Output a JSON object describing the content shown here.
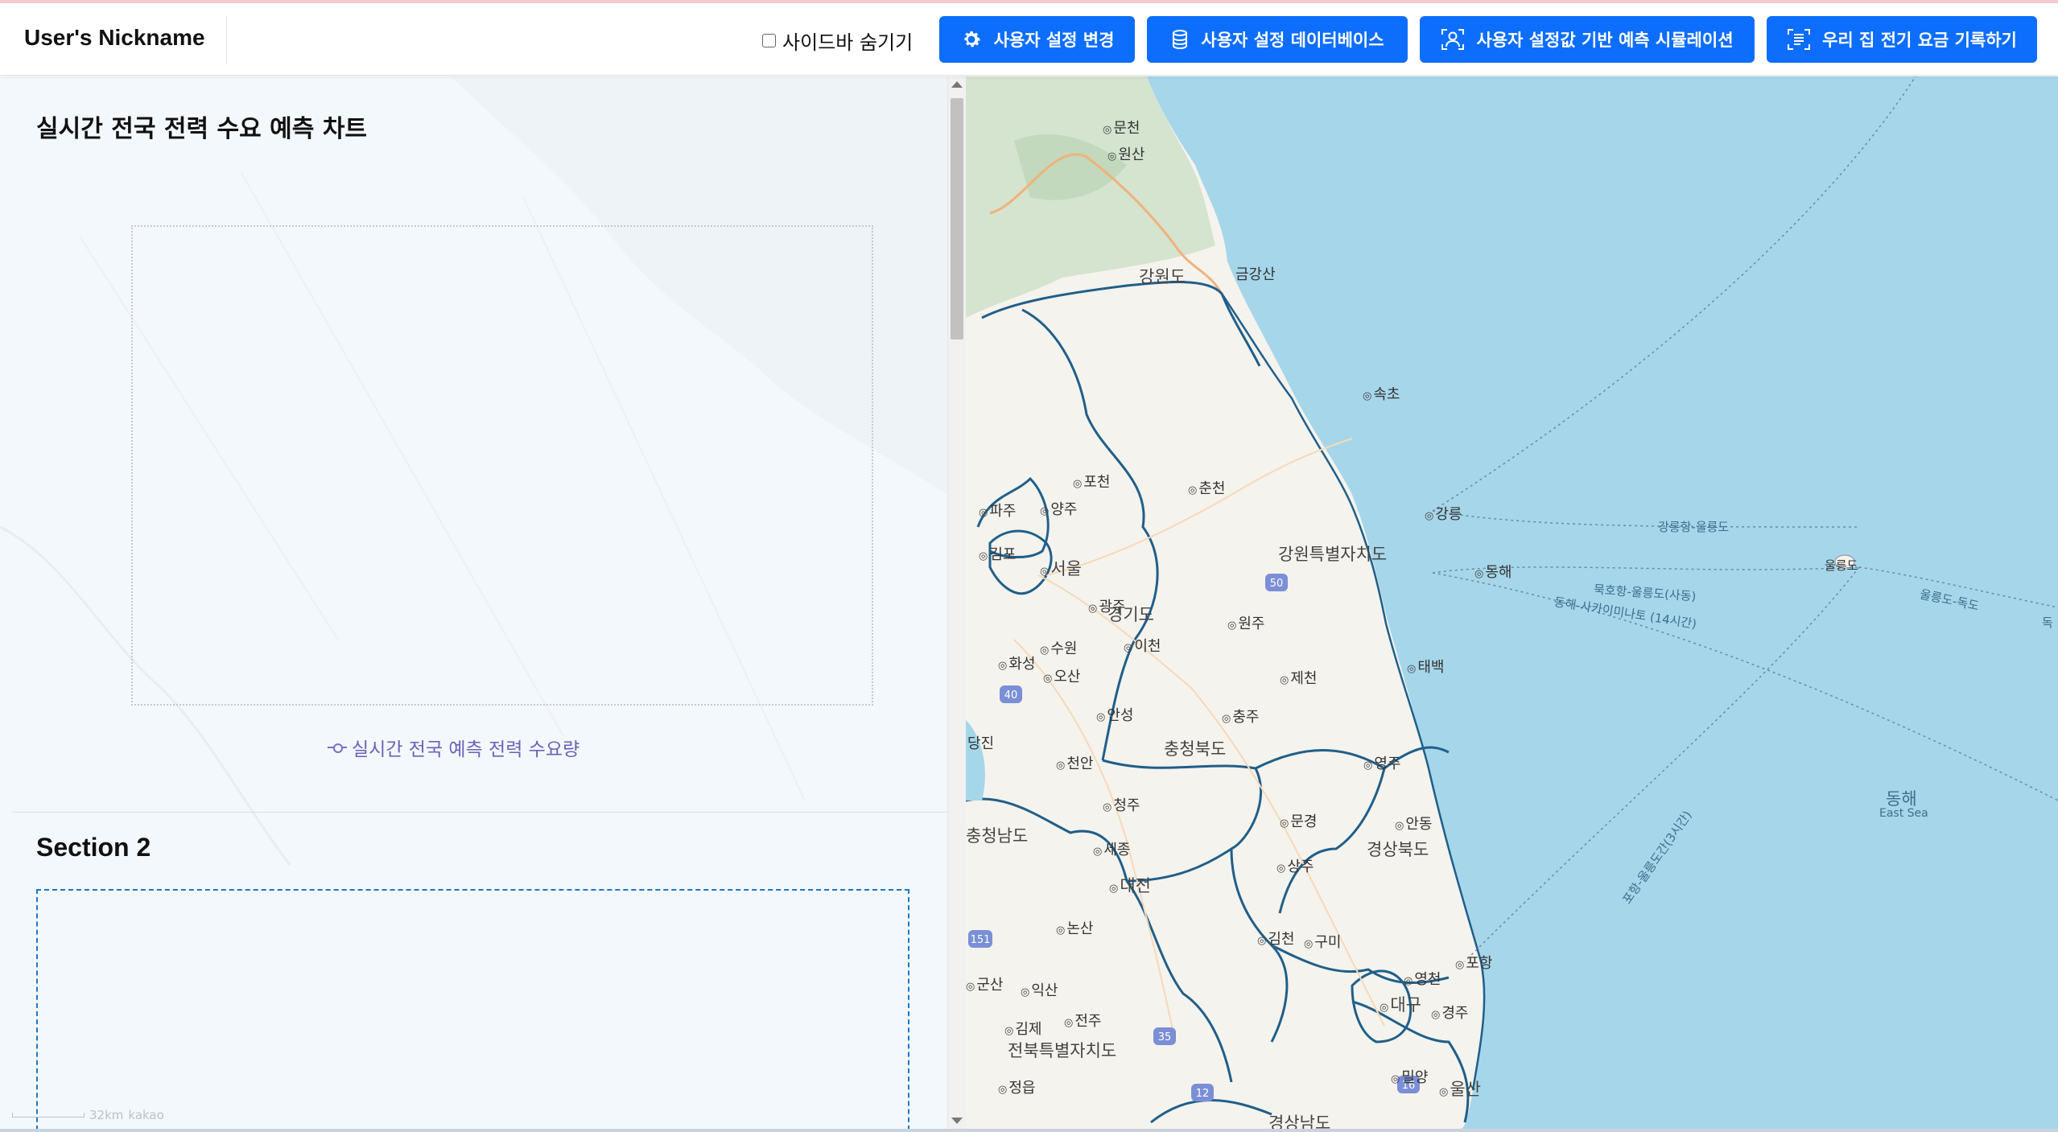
{
  "header": {
    "brand": "User's Nickname",
    "sidebar_toggle_label": "사이드바 숨기기",
    "buttons": [
      {
        "label": "사용자 설정 변경",
        "icon": "gear-icon"
      },
      {
        "label": "사용자 설정 데이터베이스",
        "icon": "database-icon"
      },
      {
        "label": "사용자 설정값 기반 예측 시뮬레이션",
        "icon": "user-scan-icon"
      },
      {
        "label": "우리 집 전기 요금 기록하기",
        "icon": "receipt-scan-icon"
      }
    ]
  },
  "left_panel": {
    "section1_title": "실시간 전국 전력 수요 예측 차트",
    "chart_legend": "실시간 전국 예측 전력 수요량",
    "section2_title": "Section 2",
    "scale_text": "32km",
    "scale_brand": "kakao"
  },
  "map": {
    "labels": {
      "munchon": "문천",
      "wonsan": "원산",
      "gangwondo": "강원도",
      "geumgangsan": "금강산",
      "sokcho": "속초",
      "pocheon": "포천",
      "chuncheon": "춘천",
      "yangju": "양주",
      "paju": "파주",
      "gangneung": "강릉",
      "gangwon_special": "강원특별자치도",
      "gimpo": "김포",
      "seoul": "서울",
      "gwangju_gg": "광주",
      "gyeonggido": "경기도",
      "wonju": "원주",
      "donghae_city": "동해",
      "suwon": "수원",
      "icheon": "이천",
      "hwaseong": "화성",
      "osan": "오산",
      "jecheon": "제천",
      "taebaek": "태백",
      "anseong": "안성",
      "chungju": "충주",
      "dangjin": "당진",
      "cheonan": "천안",
      "chungbuk": "충청북도",
      "yeongju": "영주",
      "cheongju": "청주",
      "mungyeong": "문경",
      "andong": "안동",
      "chungnam": "충청남도",
      "sejong": "세종",
      "sangju": "상주",
      "gyeongbuk": "경상북도",
      "daejeon": "대전",
      "nonsan": "논산",
      "gimcheon": "김천",
      "gumi": "구미",
      "pohang": "포항",
      "gunsan": "군산",
      "iksan": "익산",
      "yeongcheon": "영천",
      "daegu": "대구",
      "gyeongju": "경주",
      "gimje": "김제",
      "jeonju": "전주",
      "jeonbuk": "전북특별자치도",
      "miryang": "밀양",
      "ulsan": "울산",
      "jeongeup": "정읍",
      "gyeongnam": "경상남도",
      "ulleungdo": "울릉도",
      "east_sea": "동해",
      "east_sea_en": "East Sea",
      "route1": "강릉항-울릉도",
      "route2": "묵호항-울릉도(사동)",
      "route3": "동해-사카이미나토 (14시간)",
      "route4": "울릉도-독도",
      "route5": "포항-울릉도간(3시간)",
      "dok": "독"
    },
    "route_shields": [
      "50",
      "40",
      "151",
      "35",
      "12",
      "16"
    ]
  }
}
